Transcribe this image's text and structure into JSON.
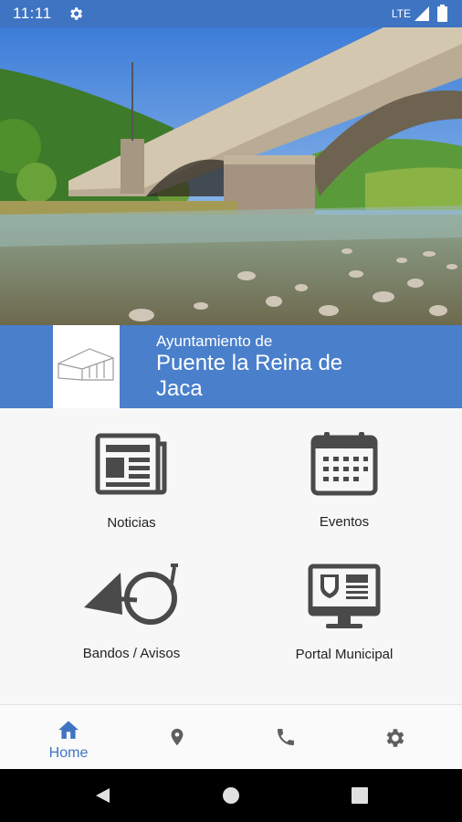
{
  "status_bar": {
    "time": "11:11",
    "network": "LTE",
    "icons": [
      "gear-icon",
      "signal-icon",
      "battery-icon"
    ]
  },
  "hero_image": {
    "description_icon": "bridge-river-photo"
  },
  "banner": {
    "line1": "Ayuntamiento de",
    "line2": "Puente la Reina de Jaca",
    "logo_icon": "town-hall-logo"
  },
  "menu": {
    "items": [
      {
        "label": "Noticias",
        "icon": "newspaper-icon"
      },
      {
        "label": "Eventos",
        "icon": "calendar-icon"
      },
      {
        "label": "Bandos / Avisos",
        "icon": "horn-icon"
      },
      {
        "label": "Portal Municipal",
        "icon": "monitor-icon"
      }
    ]
  },
  "bottom_nav": {
    "items": [
      {
        "label": "Home",
        "icon": "home-icon",
        "active": true
      },
      {
        "label": "",
        "icon": "location-icon",
        "active": false
      },
      {
        "label": "",
        "icon": "phone-icon",
        "active": false
      },
      {
        "label": "",
        "icon": "settings-icon",
        "active": false
      }
    ]
  },
  "colors": {
    "primary": "#3e74c2",
    "banner": "#4a7fcb",
    "icon_dark": "#4a4a4a",
    "nav_inactive": "#5f5f5f"
  }
}
